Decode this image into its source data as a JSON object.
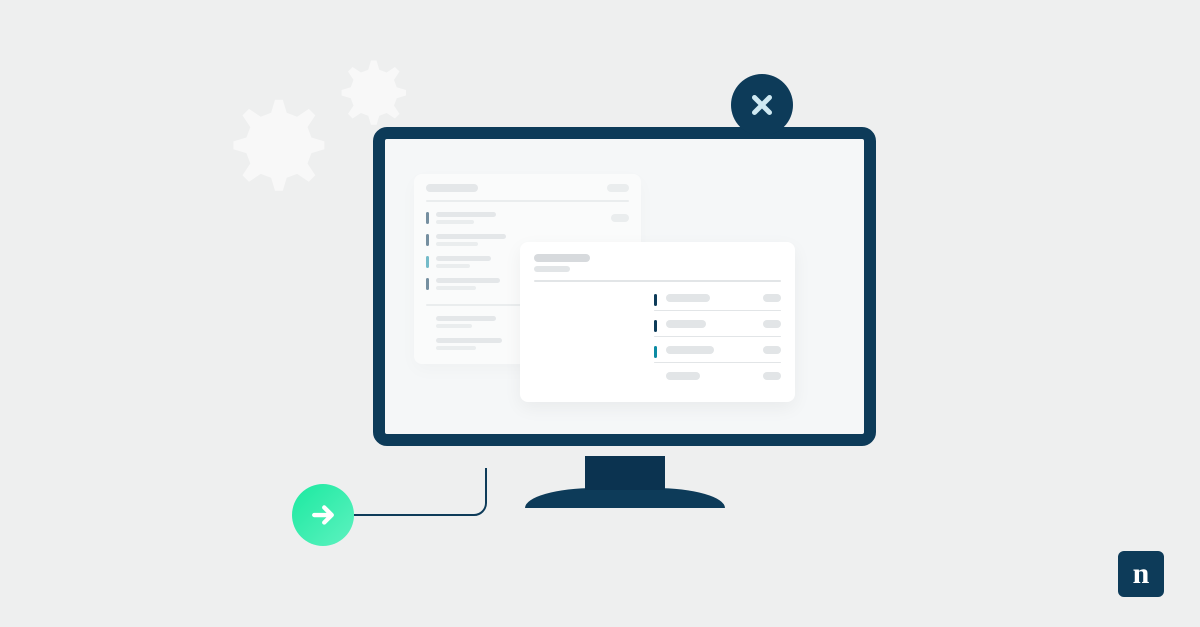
{
  "colors": {
    "background": "#eeefef",
    "navy": "#0d3b59",
    "navy_dark": "#0b3350",
    "screen": "#f5f7f8",
    "card": "#ffffff",
    "ghost": "#e2e5e7",
    "teal": "#0c8ba3",
    "mint_gradient": [
      "#1be9a0",
      "#5ef2c0"
    ]
  },
  "icons": {
    "close": "close-icon",
    "arrow_right": "arrow-right-icon",
    "gear_large": "gear-icon",
    "gear_small": "gear-icon"
  },
  "logo": {
    "letter": "n"
  }
}
